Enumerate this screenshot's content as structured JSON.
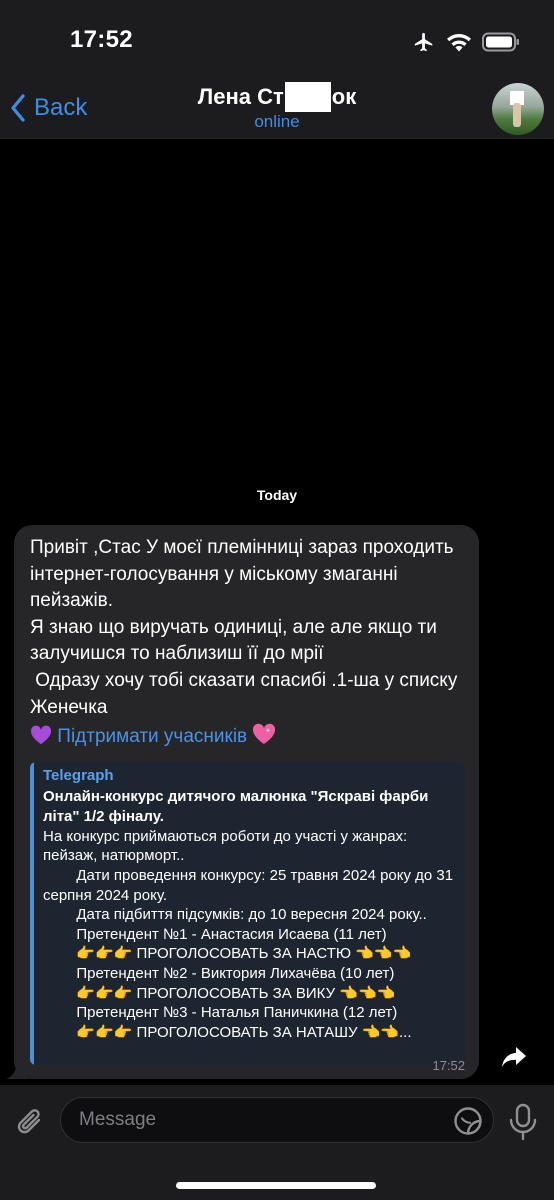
{
  "status_bar": {
    "time": "17:52",
    "icons": [
      "airplane-icon",
      "wifi-icon",
      "battery-icon"
    ]
  },
  "header": {
    "back_label": "Back",
    "contact_name_part1": "Лена Ст",
    "contact_name_part2": "ок",
    "contact_status": "online",
    "avatar": "contact-avatar-photo"
  },
  "chat": {
    "date_label": "Today",
    "message": {
      "text": "Привіт ,Стас У моєї племінниці зараз проходить інтернет-голосування у міському змаганні пейзажів.\nЯ знаю що виручать одиниці, але але якщо ти залучишся то наблизиш її до мрії\n Одразу хочу тобі сказати спасибі .1-ша у списку Женечка",
      "link_text": "Підтримати учасників",
      "link_emoji_left": "purple-heart",
      "link_emoji_right": "sparkling-heart",
      "preview": {
        "site": "Telegraph",
        "title": "Онлайн-конкурс дитячого малюнка \"Яскраві фарби літа\" 1/2 фіналу.",
        "body": "На конкурс приймаються роботи до участі у жанрах: пейзаж, натюрморт..\n        Дати проведення конкурсу: 25 травня 2024 року до 31 серпня 2024 року.\n        Дата підбиття підсумків: до 10 вересня 2024 року..\n        Претендент №1 - Анастасия Исаева (11 лет)\n        👉👉👉 ПРОГОЛОСОВАТЬ ЗА НАСТЮ 👈👈👈\n        Претендент №2 - Виктория Лихачёва (10 лет)\n        👉👉👉 ПРОГОЛОСОВАТЬ ЗА ВИКУ 👈👈👈\n        Претендент №3 - Наталья Паничкина (12 лет)\n        👉👉👉 ПРОГОЛОСОВАТЬ ЗА НАТАШУ 👈👈..."
      },
      "time": "17:52"
    }
  },
  "input_bar": {
    "placeholder": "Message",
    "icons": [
      "paperclip-icon",
      "sticker-icon",
      "microphone-icon"
    ]
  },
  "colors": {
    "accent": "#3e8ee6",
    "bubble": "#262628",
    "preview_bg": "#1d2530",
    "bar_bg": "#1c1c1e"
  }
}
